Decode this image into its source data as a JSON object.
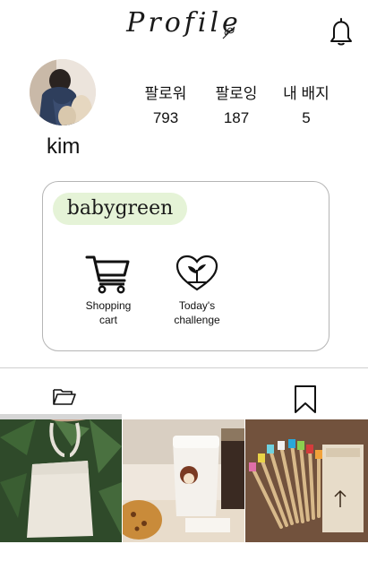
{
  "header": {
    "title": "Profile",
    "leaf_icon": "leaf-icon",
    "bell_icon": "bell-icon"
  },
  "profile": {
    "username": "kim",
    "avatar_icon": "avatar"
  },
  "stats": [
    {
      "label": "팔로워",
      "value": "793"
    },
    {
      "label": "팔로잉",
      "value": "187"
    },
    {
      "label": "내 배지",
      "value": "5"
    }
  ],
  "card": {
    "badge": "babygreen",
    "badge_color": "#e5f3d7",
    "actions": [
      {
        "label": "Shopping\ncart",
        "icon": "shopping-cart-icon"
      },
      {
        "label": "Today's\nchallenge",
        "icon": "heart-sprout-icon"
      }
    ]
  },
  "tabs": [
    {
      "icon": "folder-icon"
    },
    {
      "icon": "bookmark-icon"
    }
  ],
  "grid": {
    "photos": [
      {
        "subject": "canvas tote bag"
      },
      {
        "subject": "reusable coffee cup"
      },
      {
        "subject": "bamboo toothbrushes"
      }
    ]
  }
}
